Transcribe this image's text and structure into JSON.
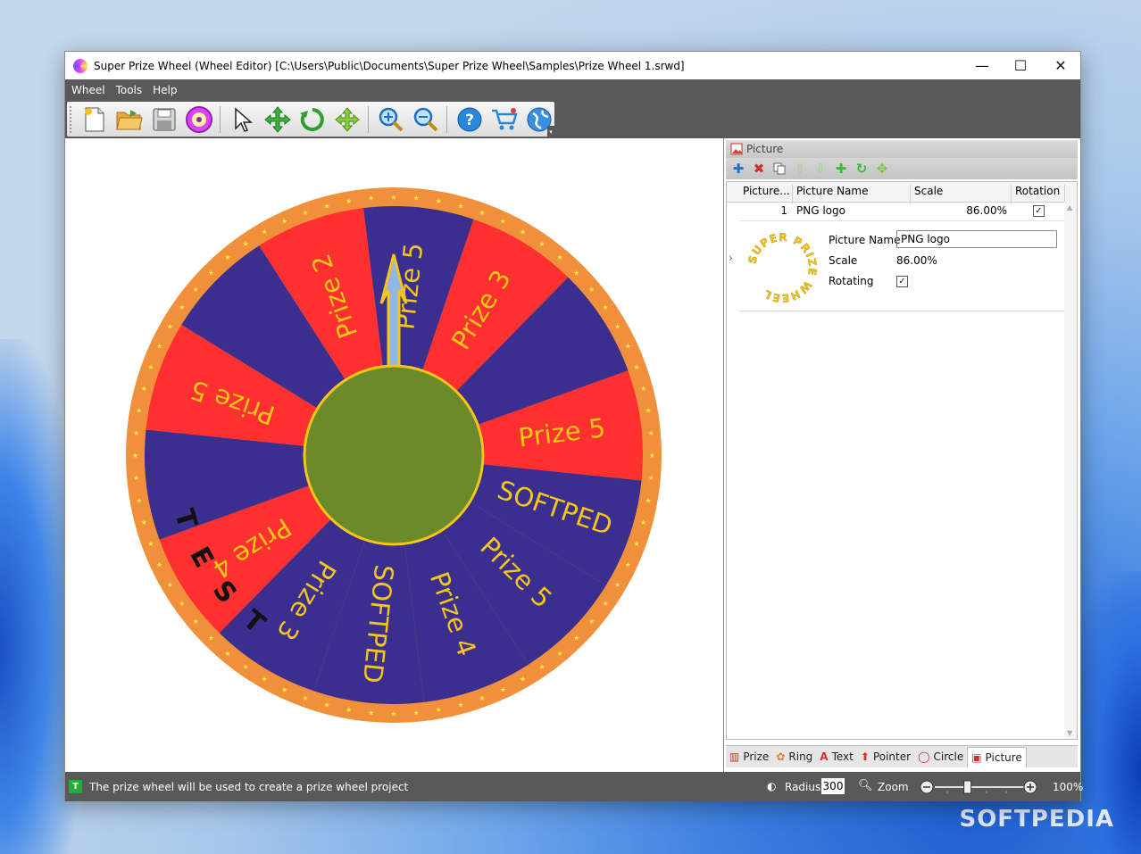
{
  "window": {
    "title": "Super Prize Wheel (Wheel Editor) [C:\\Users\\Public\\Documents\\Super Prize Wheel\\Samples\\Prize Wheel 1.srwd]",
    "minimize": "—",
    "maximize": "☐",
    "close": "✕"
  },
  "menu": [
    "Wheel",
    "Tools",
    "Help"
  ],
  "toolbar_icons": [
    "new-icon",
    "open-icon",
    "save-icon",
    "wheel-icon",
    "select-icon",
    "move-icon",
    "rotate-icon",
    "resize-icon",
    "zoom-in-icon",
    "zoom-out-icon",
    "help-icon",
    "cart-icon",
    "web-icon"
  ],
  "wheel": {
    "segments": [
      {
        "label": "Prize 5",
        "color": "#3a2f8f"
      },
      {
        "label": "Prize 3",
        "color": "#ff3030"
      },
      {
        "label": "",
        "color": "#3a2f8f"
      },
      {
        "label": "Prize 5",
        "color": "#ff3030"
      },
      {
        "label": "SOFTPED",
        "color": "#3a2f8f"
      },
      {
        "label": "Prize 5",
        "color": "#3a2f8f"
      },
      {
        "label": "Prize 4",
        "color": "#3a2f8f"
      },
      {
        "label": "SOFTPED",
        "color": "#3a2f8f"
      },
      {
        "label": "Prize 3",
        "color": "#3a2f8f"
      },
      {
        "label": "Prize 4",
        "color": "#ff3030"
      },
      {
        "label": "",
        "color": "#3a2f8f"
      },
      {
        "label": "Prize 5",
        "color": "#ff3030"
      },
      {
        "label": "",
        "color": "#3a2f8f"
      },
      {
        "label": "Prize 2",
        "color": "#ff3030"
      }
    ],
    "curved_text": "TEST",
    "ring_color": "#f0903a",
    "center_color": "#6b8a2a",
    "text_color": "#f5c518"
  },
  "panel": {
    "title": "Picture",
    "columns": [
      "Picture...",
      "Picture Name",
      "Scale",
      "Rotation"
    ],
    "row": {
      "index": "1",
      "name": "PNG logo",
      "scale": "86.00%",
      "rotation_check": "✓"
    },
    "detail": {
      "name_label": "Picture Name",
      "name_value": "PNG logo",
      "scale_label": "Scale",
      "scale_value": "86.00%",
      "rotating_label": "Rotating",
      "rotating_check": "✓",
      "logo_text": "SUPER PRIZE WHEEL"
    },
    "row_marker": "›",
    "tabs": [
      {
        "label": "Prize",
        "icon": "prize-icon"
      },
      {
        "label": "Ring",
        "icon": "ring-icon"
      },
      {
        "label": "Text",
        "icon": "text-icon"
      },
      {
        "label": "Pointer",
        "icon": "pointer-icon"
      },
      {
        "label": "Circle",
        "icon": "circle-icon"
      },
      {
        "label": "Picture",
        "icon": "picture-icon"
      }
    ]
  },
  "status": {
    "message": "The prize wheel will be used to create a prize wheel project",
    "radius_label": "Radius",
    "radius_value": "300",
    "zoom_label": "Zoom",
    "zoom_value": "100%",
    "zoom_fraction": 0.33
  },
  "watermark": "SOFTPEDIA"
}
